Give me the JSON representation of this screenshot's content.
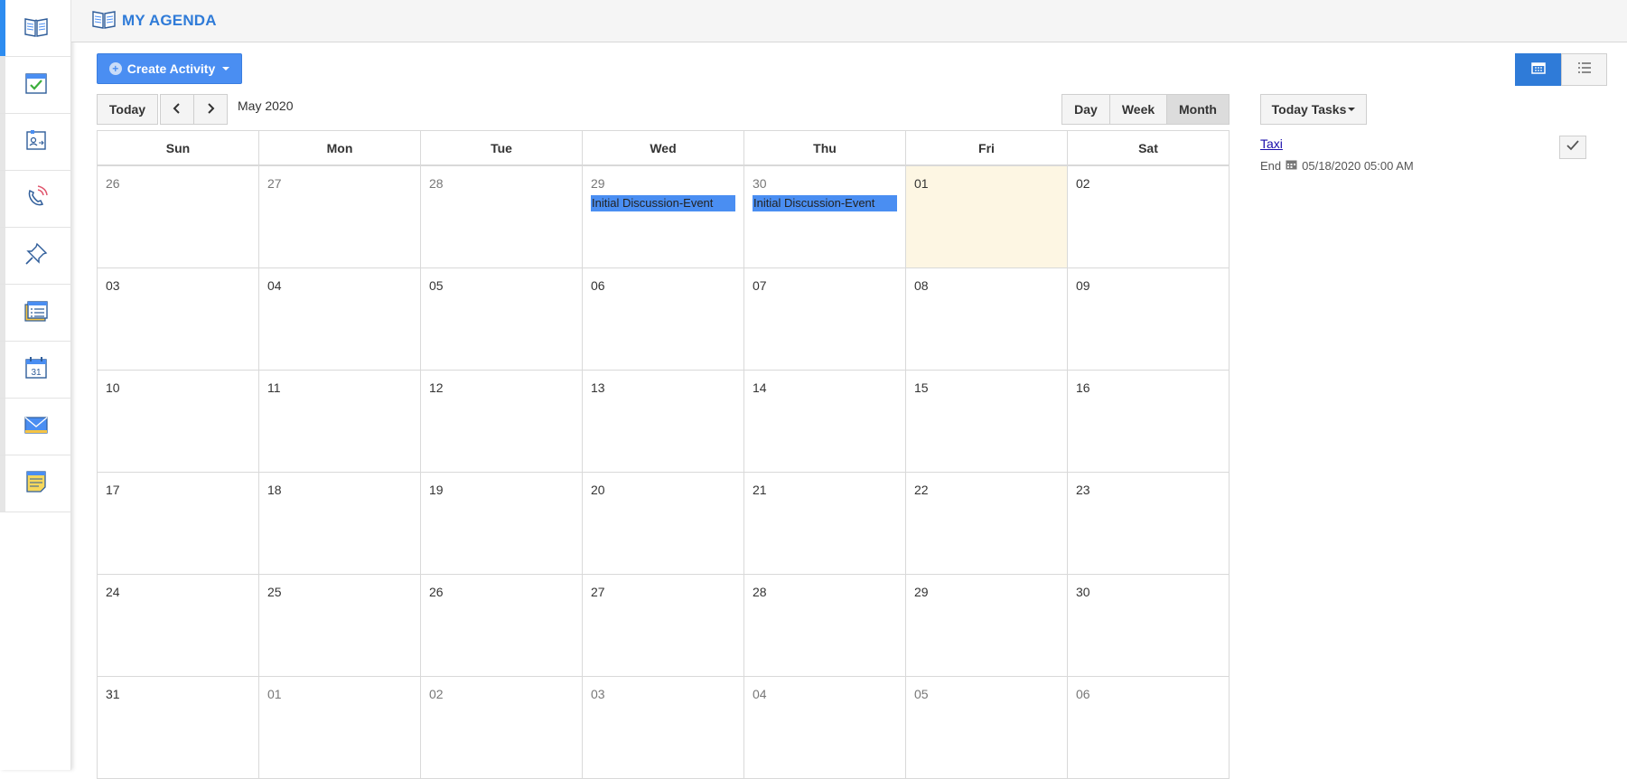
{
  "header": {
    "title": "MY AGENDA",
    "icon": "book-icon"
  },
  "sidebar": {
    "items": [
      {
        "name": "agenda",
        "icon": "book-icon",
        "active": true
      },
      {
        "name": "tasks",
        "icon": "checklist-icon",
        "active": false
      },
      {
        "name": "contacts",
        "icon": "contact-card-icon",
        "active": false
      },
      {
        "name": "calls",
        "icon": "phone-icon",
        "active": false
      },
      {
        "name": "pins",
        "icon": "pin-icon",
        "active": false
      },
      {
        "name": "forms",
        "icon": "form-list-icon",
        "active": false
      },
      {
        "name": "calendar",
        "icon": "calendar-31-icon",
        "active": false
      },
      {
        "name": "email",
        "icon": "envelope-icon",
        "active": false
      },
      {
        "name": "notes",
        "icon": "note-icon",
        "active": false
      }
    ]
  },
  "toolbar": {
    "create_label": "Create Activity",
    "today_label": "Today",
    "month_label": "May 2020",
    "views": {
      "day": "Day",
      "week": "Week",
      "month": "Month"
    },
    "active_view": "Month"
  },
  "calendar": {
    "weekdays": [
      "Sun",
      "Mon",
      "Tue",
      "Wed",
      "Thu",
      "Fri",
      "Sat"
    ],
    "weeks": [
      [
        {
          "day": "26",
          "other": true
        },
        {
          "day": "27",
          "other": true
        },
        {
          "day": "28",
          "other": true
        },
        {
          "day": "29",
          "other": true,
          "event": "Initial Discussion-Event"
        },
        {
          "day": "30",
          "other": true,
          "event": "Initial Discussion-Event"
        },
        {
          "day": "01",
          "today": true
        },
        {
          "day": "02"
        }
      ],
      [
        {
          "day": "03"
        },
        {
          "day": "04"
        },
        {
          "day": "05"
        },
        {
          "day": "06"
        },
        {
          "day": "07"
        },
        {
          "day": "08"
        },
        {
          "day": "09"
        }
      ],
      [
        {
          "day": "10"
        },
        {
          "day": "11"
        },
        {
          "day": "12"
        },
        {
          "day": "13"
        },
        {
          "day": "14"
        },
        {
          "day": "15"
        },
        {
          "day": "16"
        }
      ],
      [
        {
          "day": "17"
        },
        {
          "day": "18"
        },
        {
          "day": "19"
        },
        {
          "day": "20"
        },
        {
          "day": "21"
        },
        {
          "day": "22"
        },
        {
          "day": "23"
        }
      ],
      [
        {
          "day": "24"
        },
        {
          "day": "25"
        },
        {
          "day": "26"
        },
        {
          "day": "27"
        },
        {
          "day": "28"
        },
        {
          "day": "29"
        },
        {
          "day": "30"
        }
      ],
      [
        {
          "day": "31"
        },
        {
          "day": "01",
          "other": true
        },
        {
          "day": "02",
          "other": true
        },
        {
          "day": "03",
          "other": true
        },
        {
          "day": "04",
          "other": true
        },
        {
          "day": "05",
          "other": true
        },
        {
          "day": "06",
          "other": true
        }
      ]
    ],
    "event_color": "#4a8ef2",
    "today_color": "#fdf6e3"
  },
  "tasks_panel": {
    "dropdown_label": "Today Tasks",
    "task": {
      "title": "Taxi",
      "end_label": "End",
      "end_value": "05/18/2020 05:00 AM"
    }
  },
  "colors": {
    "accent": "#2f7bd8",
    "primary_button": "#4a8ef2"
  }
}
